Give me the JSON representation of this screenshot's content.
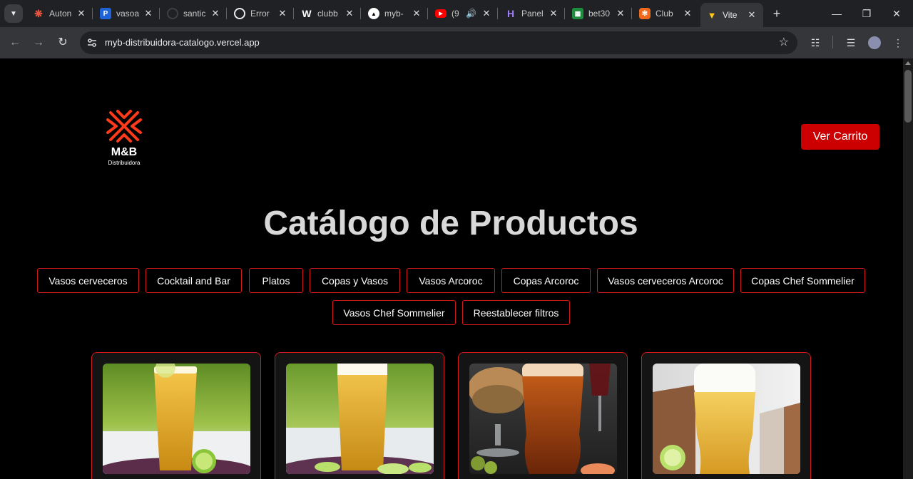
{
  "browser": {
    "tabs": [
      {
        "title": "Auton",
        "icon": "sunburst-favicon-icon",
        "color": "#e8553e"
      },
      {
        "title": "vasoa",
        "icon": "p-favicon-icon",
        "color": "#1e64d8"
      },
      {
        "title": "santic",
        "icon": "github-favicon-icon",
        "color": "#3a3a3a"
      },
      {
        "title": "Error",
        "icon": "openai-favicon-icon",
        "color": "#ffffff"
      },
      {
        "title": "clubb",
        "icon": "w-favicon-icon",
        "color": "#ffffff"
      },
      {
        "title": "myb-",
        "icon": "vercel-favicon-icon",
        "color": "#000000"
      },
      {
        "title": "(9",
        "icon": "youtube-favicon-icon",
        "color": "#ff0000"
      },
      {
        "title": "Panel",
        "icon": "h-favicon-icon",
        "color": "#7a4ee6"
      },
      {
        "title": "bet30",
        "icon": "sheet-favicon-icon",
        "color": "#1e8e3e"
      },
      {
        "title": "Club",
        "icon": "club-favicon-icon",
        "color": "#f06a1d"
      },
      {
        "title": "Vite",
        "icon": "vite-favicon-icon",
        "color": "#a97bff"
      }
    ],
    "url": "myb-distribuidora-catalogo.vercel.app"
  },
  "page": {
    "logo": {
      "name": "M&B",
      "subtitle": "Distribuidora",
      "color": "#ff3a1a"
    },
    "cart_button": "Ver Carrito",
    "title": "Catálogo de Productos",
    "filters": [
      "Vasos cerveceros",
      "Cocktail and Bar",
      "Platos",
      "Copas y Vasos",
      "Vasos Arcoroc",
      "Copas Arcoroc",
      "Vasos cerveceros Arcoroc",
      "Copas Chef Sommelier",
      "Vasos Chef Sommelier",
      "Reestablecer filtros"
    ],
    "products": [
      {
        "image": "beer-glass-lime-photo"
      },
      {
        "image": "beer-glass-lime-slices-photo"
      },
      {
        "image": "beer-mug-nuts-photo"
      },
      {
        "image": "beer-glass-foam-photo"
      }
    ],
    "accent": "#d21a1a"
  }
}
